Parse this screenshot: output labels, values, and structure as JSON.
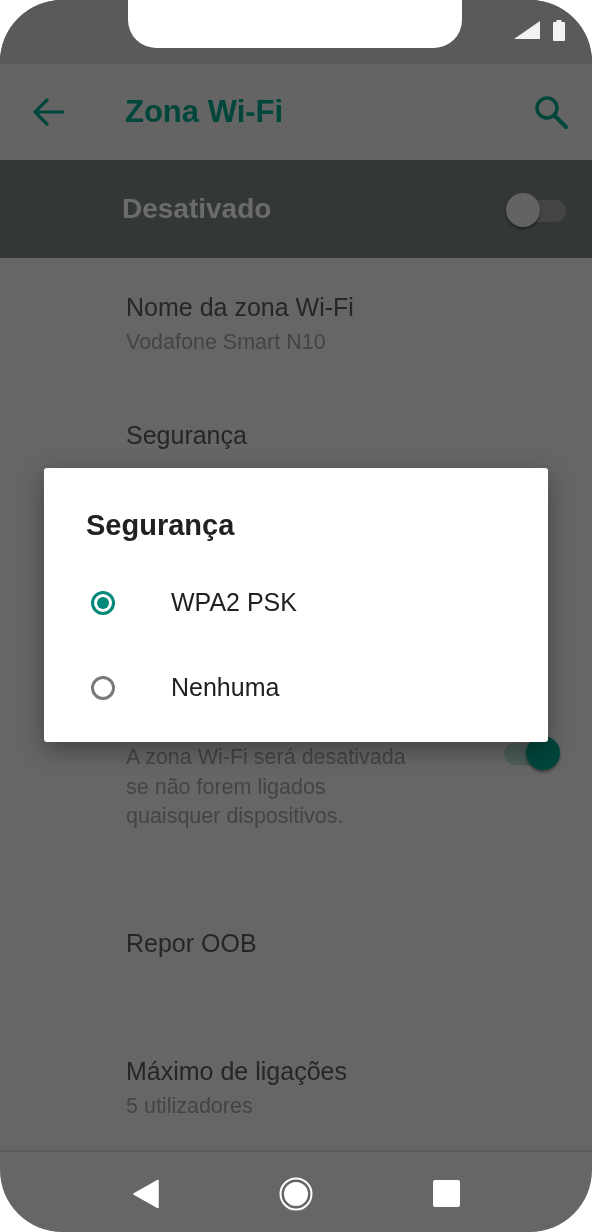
{
  "app_bar": {
    "title": "Zona Wi-Fi"
  },
  "master_switch": {
    "label": "Desativado",
    "on": false
  },
  "settings": [
    {
      "kind": "text",
      "title": "Nome da zona Wi-Fi",
      "summary": "Vodafone Smart N10"
    },
    {
      "kind": "text",
      "title": "Segurança"
    },
    {
      "kind": "switch",
      "summary": "A zona Wi-Fi será desativada\nse não forem ligados\nquaisquer dispositivos.",
      "on": true
    },
    {
      "kind": "text",
      "title": "Repor OOB"
    },
    {
      "kind": "text",
      "title": "Máximo de ligações",
      "summary": "5 utilizadores"
    }
  ],
  "dialog": {
    "title": "Segurança",
    "options": [
      {
        "label": "WPA2 PSK",
        "selected": true
      },
      {
        "label": "Nenhuma",
        "selected": false
      }
    ]
  }
}
